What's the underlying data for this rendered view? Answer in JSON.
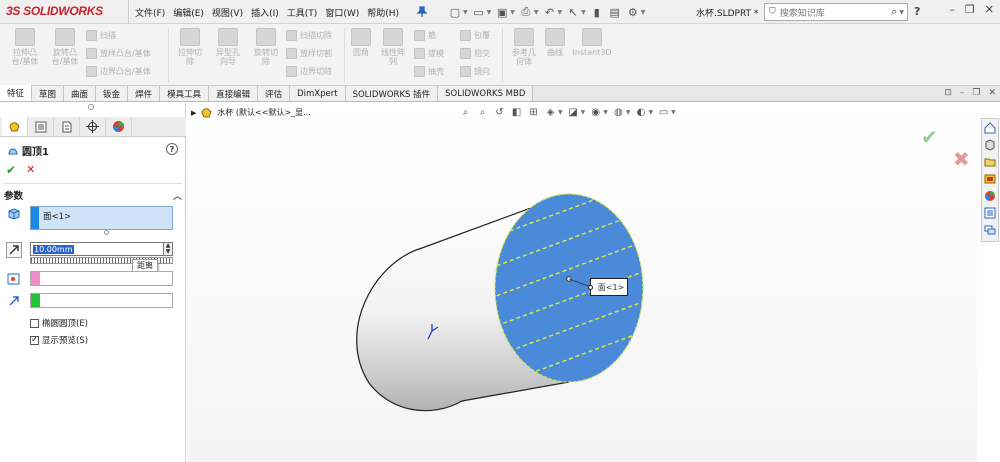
{
  "app": {
    "logo_ds": "3S",
    "logo_text": "SOLIDWORKS",
    "document_name": "水杯.SLDPRT *",
    "search_placeholder": "搜索知识库"
  },
  "menu": [
    "文件(F)",
    "编辑(E)",
    "视图(V)",
    "插入(I)",
    "工具(T)",
    "窗口(W)",
    "帮助(H)"
  ],
  "ribbon": {
    "buttons": [
      {
        "label": "拉伸凸\n台/基体"
      },
      {
        "label": "旋转凸\n台/基体"
      },
      {
        "label": "拉伸切\n除"
      },
      {
        "label": "异型孔\n向导"
      },
      {
        "label": "旋转切\n除"
      },
      {
        "label": "圆角"
      },
      {
        "label": "线性阵\n列"
      },
      {
        "label": "参考几\n何体"
      },
      {
        "label": "曲线"
      },
      {
        "label": "Instant3D"
      }
    ],
    "small": {
      "sweep": "扫描",
      "loft": "放样凸台/基体",
      "boundary": "边界凸台/基体",
      "sweep_cut": "扫描切除",
      "loft_cut": "放样切割",
      "boundary_cut": "边界切除",
      "rib": "筋",
      "draft": "拔模",
      "shell": "抽壳",
      "wrap": "包覆",
      "intersect": "相交",
      "mirror": "镜向"
    }
  },
  "tabs": [
    "特征",
    "草图",
    "曲面",
    "钣金",
    "焊件",
    "模具工具",
    "直接编辑",
    "评估",
    "DimXpert",
    "SOLIDWORKS 插件",
    "SOLIDWORKS MBD"
  ],
  "panel": {
    "title": "圆顶1",
    "help": "?",
    "section": "参数",
    "face_selection": "面<1>",
    "distance_value": "10.00mm",
    "distance_tooltip": "距离",
    "elliptical_dome_label": "椭圆圆顶(E)",
    "elliptical_dome_checked": false,
    "show_preview_label": "显示预览(S)",
    "show_preview_checked": true,
    "colors": {
      "face": "#1e88e5",
      "pink": "#f28cc8",
      "green": "#22c33a"
    }
  },
  "viewport": {
    "tree_label": "水杯  (默认<<默认>_显...",
    "face_callout": "面<1>",
    "colors": {
      "face": "#4a8ad8",
      "edge_highlight": "#d7e84a"
    }
  }
}
